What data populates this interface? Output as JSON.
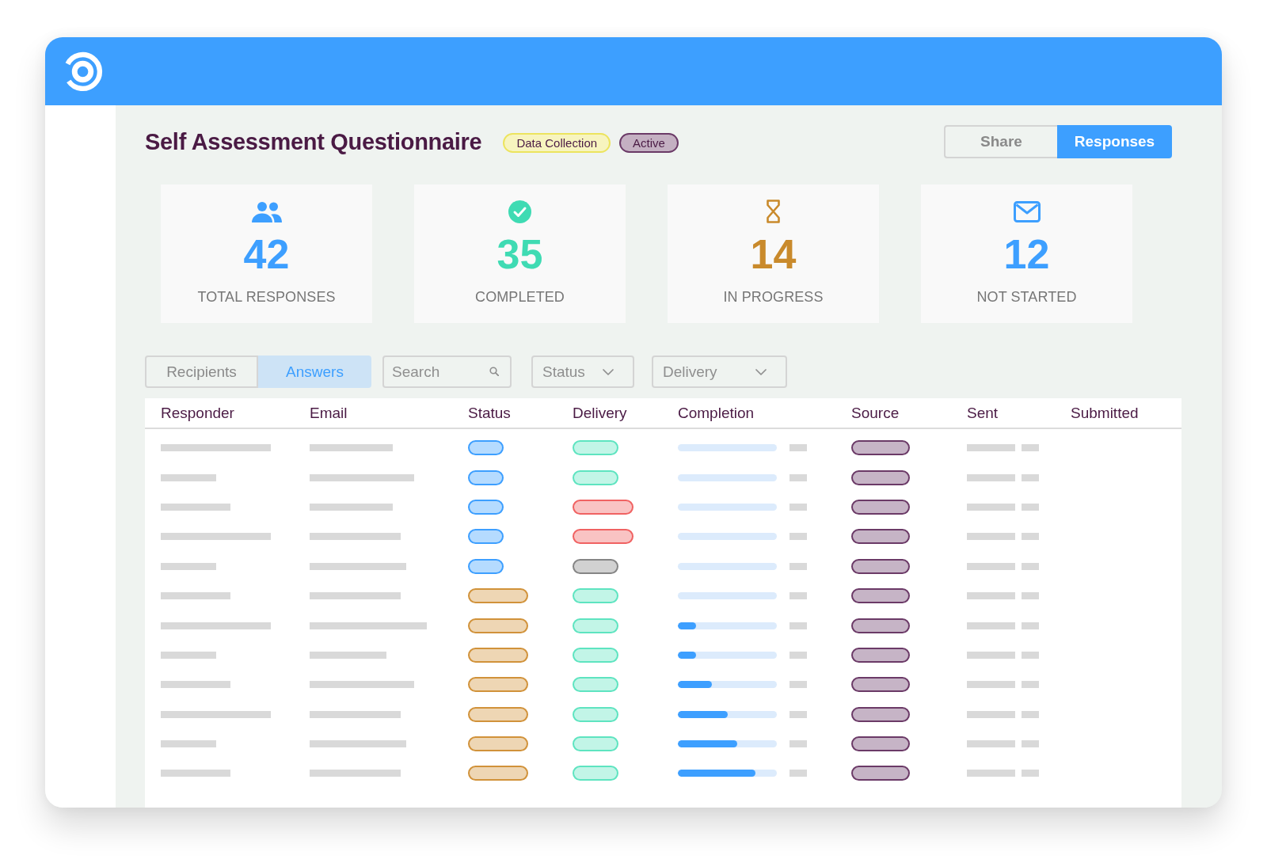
{
  "page": {
    "title": "Self Assessment Questionnaire",
    "badges": [
      {
        "label": "Data Collection",
        "color": "#ece45e"
      },
      {
        "label": "Active",
        "color": "#6b3a67"
      }
    ]
  },
  "view_tabs": [
    {
      "label": "Share",
      "selected": false
    },
    {
      "label": "Responses",
      "selected": true
    }
  ],
  "stats": [
    {
      "value": "42",
      "label": "TOTAL RESPONSES",
      "color": "#3d9fff"
    },
    {
      "value": "35",
      "label": "COMPLETED",
      "color": "#3fdbb3"
    },
    {
      "value": "14",
      "label": "IN PROGRESS",
      "color": "#c98a2c"
    },
    {
      "value": "12",
      "label": "NOT STARTED",
      "color": "#3d9fff"
    }
  ],
  "toolbar": {
    "tabs": [
      {
        "label": "Recipients",
        "selected": false
      },
      {
        "label": "Answers",
        "selected": true
      }
    ],
    "search": {
      "placeholder": "Search"
    },
    "filters": [
      {
        "label": "Status"
      },
      {
        "label": "Delivery"
      }
    ]
  },
  "table": {
    "columns": [
      "Responder",
      "Email",
      "Status",
      "Delivery",
      "Completion",
      "Source",
      "Sent",
      "Submitted"
    ],
    "rows": [
      {
        "status": {
          "kind": "short",
          "color": "#3d9fff"
        },
        "delivery": {
          "kind": "short",
          "color": "#5ee4c0"
        }
      },
      {
        "status": {
          "kind": "short",
          "color": "#3d9fff"
        },
        "delivery": {
          "kind": "short",
          "color": "#5ee4c0"
        }
      },
      {
        "status": {
          "kind": "short",
          "color": "#3d9fff"
        },
        "delivery": {
          "kind": "long",
          "color": "#f06262"
        }
      },
      {
        "status": {
          "kind": "short",
          "color": "#3d9fff"
        },
        "delivery": {
          "kind": "long",
          "color": "#f06262"
        }
      },
      {
        "status": {
          "kind": "short",
          "color": "#3d9fff"
        },
        "delivery": {
          "kind": "short",
          "color": "#858585"
        }
      },
      {
        "status": {
          "kind": "long",
          "color": "#d1923a"
        },
        "delivery": {
          "kind": "short",
          "color": "#5ee4c0"
        }
      },
      {
        "status": {
          "kind": "long",
          "color": "#d1923a"
        },
        "delivery": {
          "kind": "short",
          "color": "#5ee4c0"
        },
        "completion": {
          "level": 0.18
        }
      },
      {
        "status": {
          "kind": "long",
          "color": "#d1923a"
        },
        "delivery": {
          "kind": "short",
          "color": "#5ee4c0"
        },
        "completion": {
          "level": 0.18
        }
      },
      {
        "status": {
          "kind": "long",
          "color": "#d1923a"
        },
        "delivery": {
          "kind": "short",
          "color": "#5ee4c0"
        },
        "completion": {
          "level": 0.34
        }
      },
      {
        "status": {
          "kind": "long",
          "color": "#d1923a"
        },
        "delivery": {
          "kind": "short",
          "color": "#5ee4c0"
        },
        "completion": {
          "level": 0.5
        }
      },
      {
        "status": {
          "kind": "long",
          "color": "#d1923a"
        },
        "delivery": {
          "kind": "short",
          "color": "#5ee4c0"
        },
        "completion": {
          "level": 0.6
        }
      },
      {
        "status": {
          "kind": "long",
          "color": "#d1923a"
        },
        "delivery": {
          "kind": "short",
          "color": "#5ee4c0"
        },
        "completion": {
          "level": 0.78
        }
      }
    ]
  }
}
